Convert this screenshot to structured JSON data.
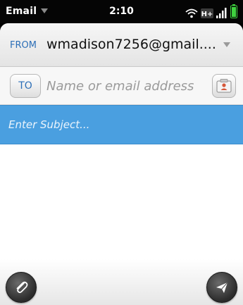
{
  "status_bar": {
    "app_name": "Email",
    "time": "2:10",
    "icons": [
      "wifi-icon",
      "hspa-plus-icon",
      "signal-bars-icon",
      "battery-icon"
    ],
    "network_label": "H+"
  },
  "compose": {
    "from_label": "FROM",
    "from_value": "wmadison7256@gmail....",
    "to_button_label": "TO",
    "to_placeholder": "Name or email address",
    "subject_placeholder": "Enter Subject...",
    "body_value": ""
  },
  "actions": {
    "attach_icon": "paperclip-icon",
    "send_icon": "send-icon",
    "contact_icon": "contact-card-icon"
  },
  "colors": {
    "accent": "#2d6fb7",
    "subject_highlight": "#4a9fe0",
    "battery": "#3fd23f"
  }
}
